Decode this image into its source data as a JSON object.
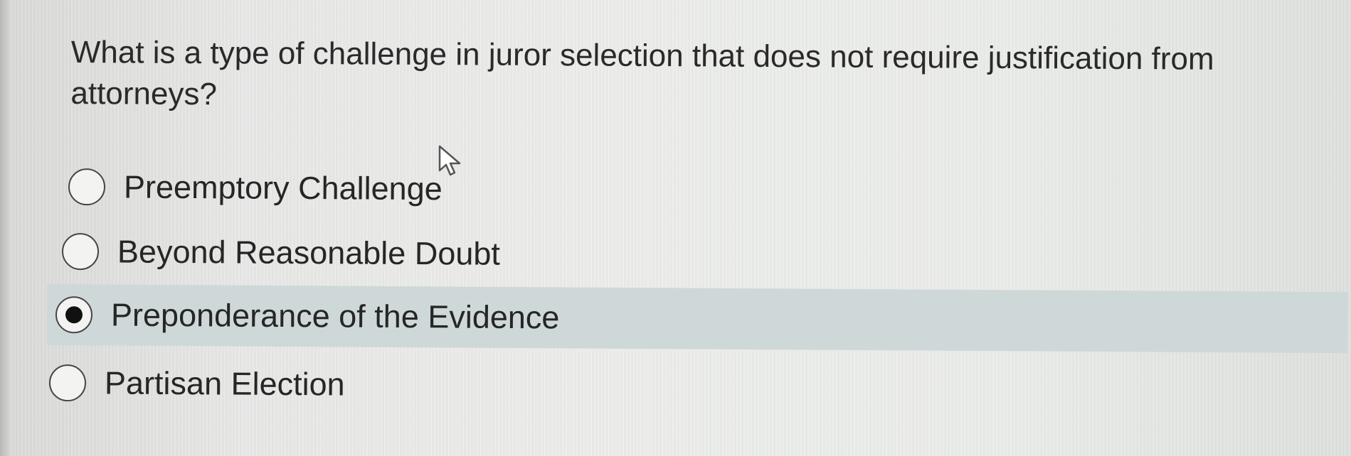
{
  "question": {
    "text": "What is a type of challenge in juror selection that does not require justification from attorneys?"
  },
  "options": [
    {
      "label": "Preemptory Challenge",
      "selected": false
    },
    {
      "label": "Beyond Reasonable Doubt",
      "selected": false
    },
    {
      "label": "Preponderance of the Evidence",
      "selected": true
    },
    {
      "label": "Partisan Election",
      "selected": false
    }
  ],
  "cursor": {
    "icon": "pointer-arrow-icon"
  },
  "colors": {
    "background": "#e8e9e7",
    "selected_row": "#cfd8d8",
    "text": "#2a2a2a"
  }
}
